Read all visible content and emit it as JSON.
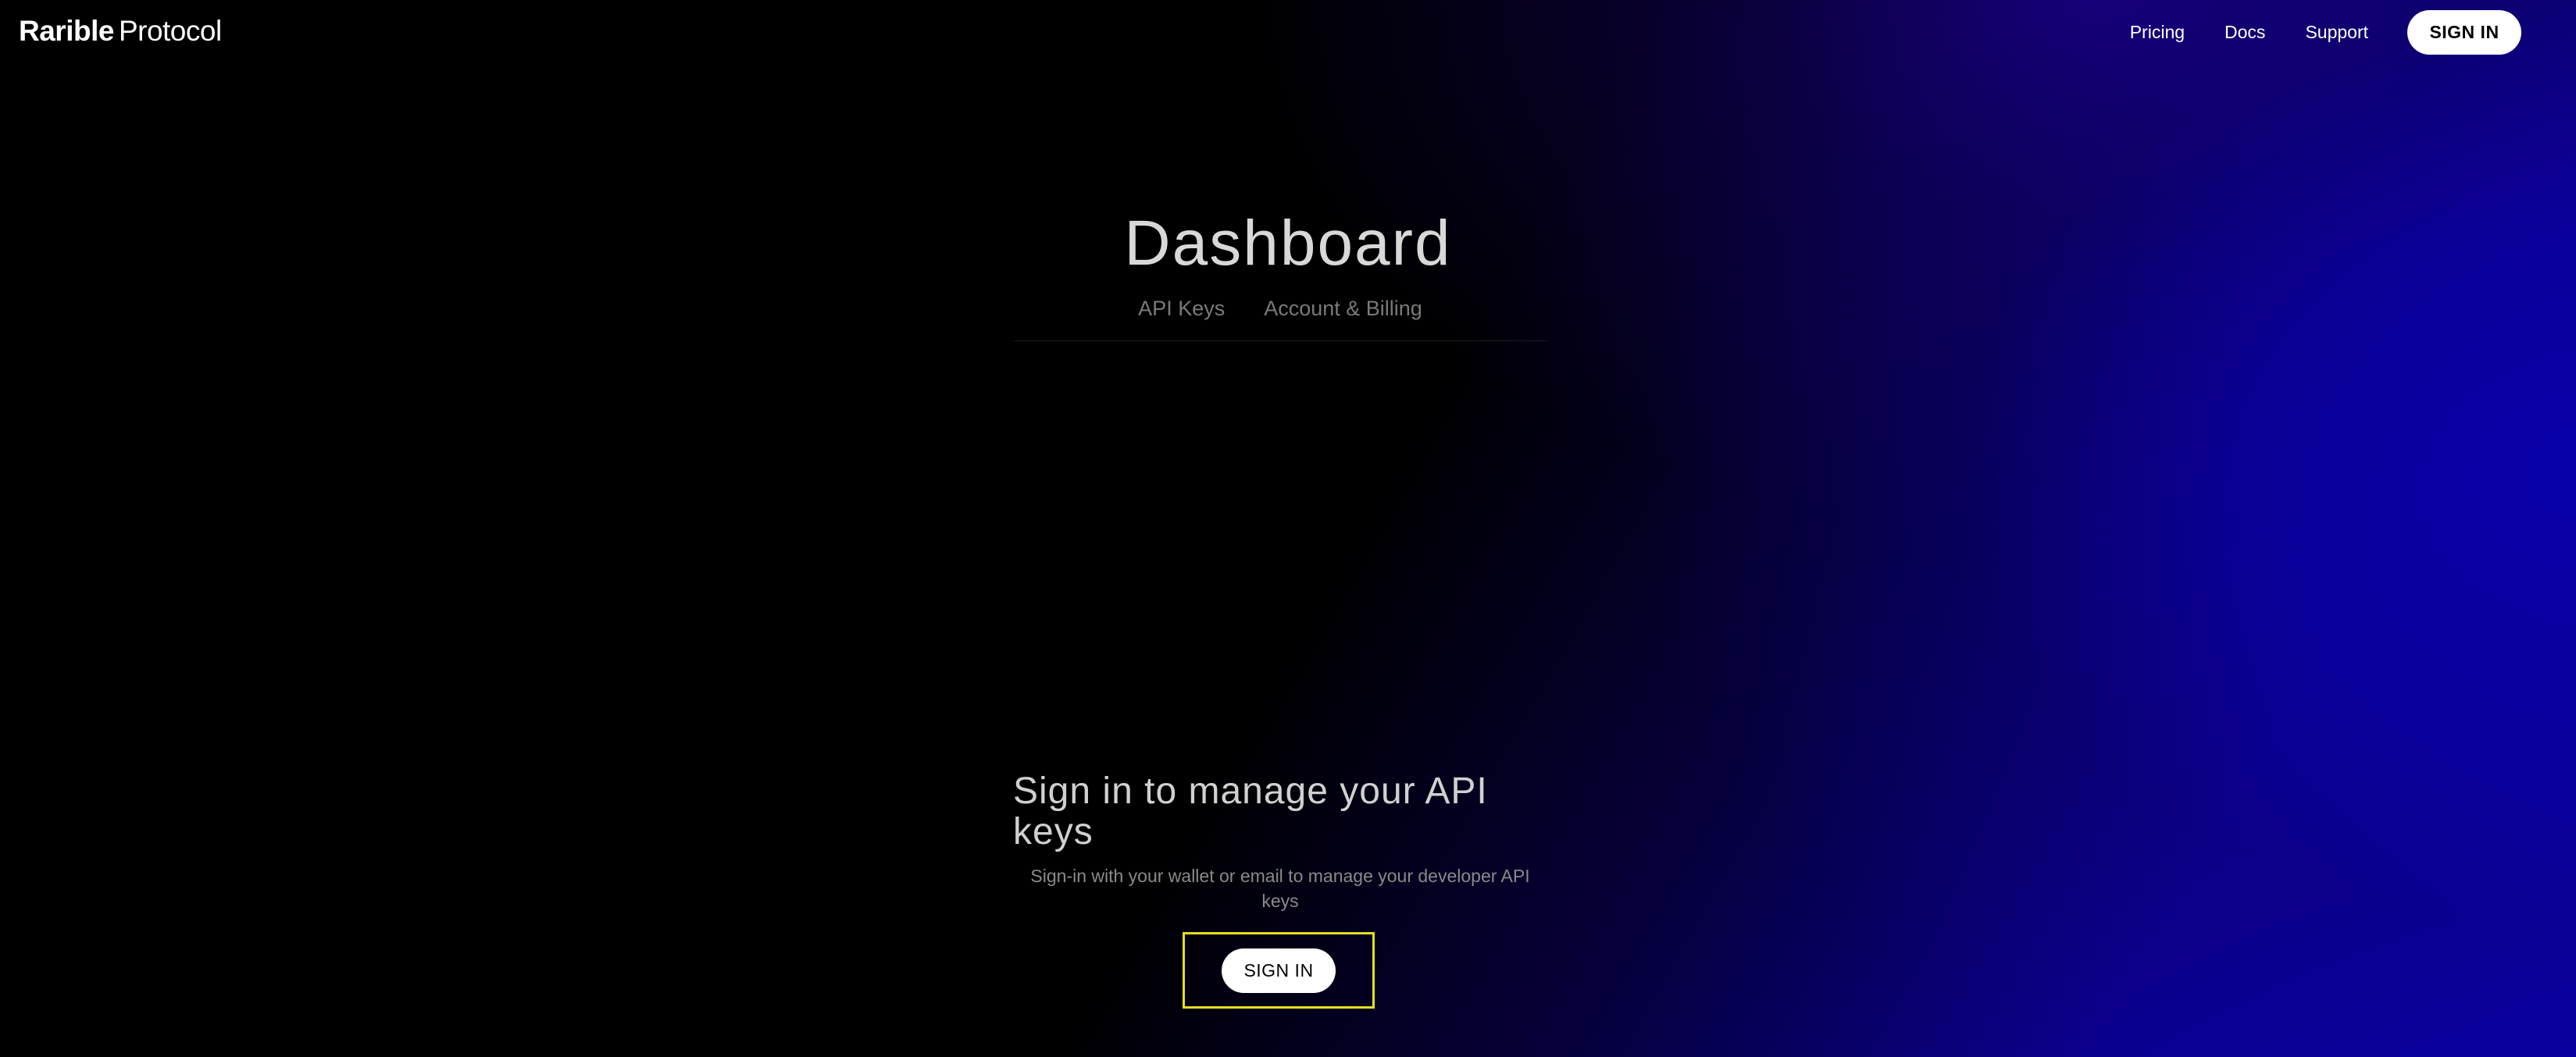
{
  "header": {
    "logo_brand": "Rarible",
    "logo_suffix": "Protocol",
    "nav": {
      "pricing": "Pricing",
      "docs": "Docs",
      "support": "Support"
    },
    "signin_label": "SIGN IN"
  },
  "main": {
    "title": "Dashboard",
    "tabs": [
      "API Keys",
      "Account & Billing"
    ],
    "panel": {
      "heading": "Sign in to manage your API keys",
      "subtext": "Sign-in with your wallet or email to manage your developer API keys",
      "signin_label": "SIGN IN"
    }
  },
  "colors": {
    "background": "#000000",
    "accent_gradient": "#0a00a8",
    "highlight_frame": "#e6de22",
    "button_bg": "#ffffff",
    "button_text": "#000000"
  }
}
